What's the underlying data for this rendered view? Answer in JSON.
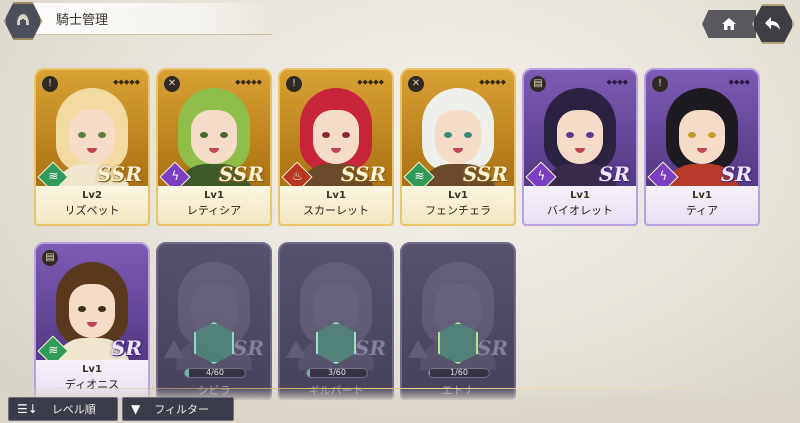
{
  "header": {
    "title": "騎士管理",
    "emblem_icon": "helmet-icon",
    "home_icon": "home-icon",
    "back_icon": "back-arrow-icon"
  },
  "cards": [
    {
      "rarity": "SSR",
      "level": "Lv2",
      "name": "リズベット",
      "element": "wind",
      "element_glyph": "≋",
      "class_glyph": "!",
      "stars": "◆◆◆◆◆",
      "hair": "#f2dba0",
      "eyes": "#5a7a3a",
      "body": "#efe6cf"
    },
    {
      "rarity": "SSR",
      "level": "Lv1",
      "name": "レティシア",
      "element": "lightning",
      "element_glyph": "ϟ",
      "class_glyph": "✕",
      "stars": "◆◆◆◆◆",
      "hair": "#8fbf4a",
      "eyes": "#4a6a2a",
      "body": "#3f5a2a"
    },
    {
      "rarity": "SSR",
      "level": "Lv1",
      "name": "スカーレット",
      "element": "fire",
      "element_glyph": "♨",
      "class_glyph": "!",
      "stars": "◆◆◆◆◆",
      "hair": "#c8243a",
      "eyes": "#8a2a2a",
      "body": "#6a4a2a"
    },
    {
      "rarity": "SSR",
      "level": "Lv1",
      "name": "フェンチェラ",
      "element": "wind",
      "element_glyph": "≋",
      "class_glyph": "✕",
      "stars": "◆◆◆◆◆",
      "hair": "#eeeeea",
      "eyes": "#3a8a7a",
      "body": "#6a4a2a"
    },
    {
      "rarity": "SR",
      "level": "Lv1",
      "name": "バイオレット",
      "element": "lightning",
      "element_glyph": "ϟ",
      "class_glyph": "▤",
      "stars": "◆◆◆◆",
      "hair": "#2a2240",
      "eyes": "#5a3a8a",
      "body": "#3a2a4a"
    },
    {
      "rarity": "SR",
      "level": "Lv1",
      "name": "ティア",
      "element": "lightning",
      "element_glyph": "ϟ",
      "class_glyph": "!",
      "stars": "◆◆◆◆",
      "hair": "#1e1a22",
      "eyes": "#c89a2a",
      "body": "#b83a2a"
    },
    {
      "rarity": "SR",
      "level": "Lv1",
      "name": "ディオニス",
      "element": "wind",
      "element_glyph": "≋",
      "class_glyph": "▤",
      "stars": "",
      "hair": "#5a3a1e",
      "eyes": "#3a2a1a",
      "body": "#efe6cf"
    }
  ],
  "locked_cards": [
    {
      "rarity": "SR",
      "progress": "4/60",
      "progress_value": 4,
      "progress_max": 60,
      "name": "シビラ",
      "mini_color": "#8fd6c8"
    },
    {
      "rarity": "SR",
      "progress": "3/60",
      "progress_value": 3,
      "progress_max": 60,
      "name": "ギルバート",
      "mini_color": "#9fe0c8"
    },
    {
      "rarity": "SR",
      "progress": "1/60",
      "progress_value": 1,
      "progress_max": 60,
      "name": "エトナ",
      "mini_color": "#b8e08a"
    }
  ],
  "toolbar": {
    "sort_label": "レベル順",
    "sort_icon": "sort-icon",
    "filter_label": "フィルター",
    "filter_icon": "filter-icon"
  },
  "colors": {
    "ssr_gold": "#d9a235",
    "sr_purple": "#7d5bb4",
    "locked": "#4f4a66"
  }
}
